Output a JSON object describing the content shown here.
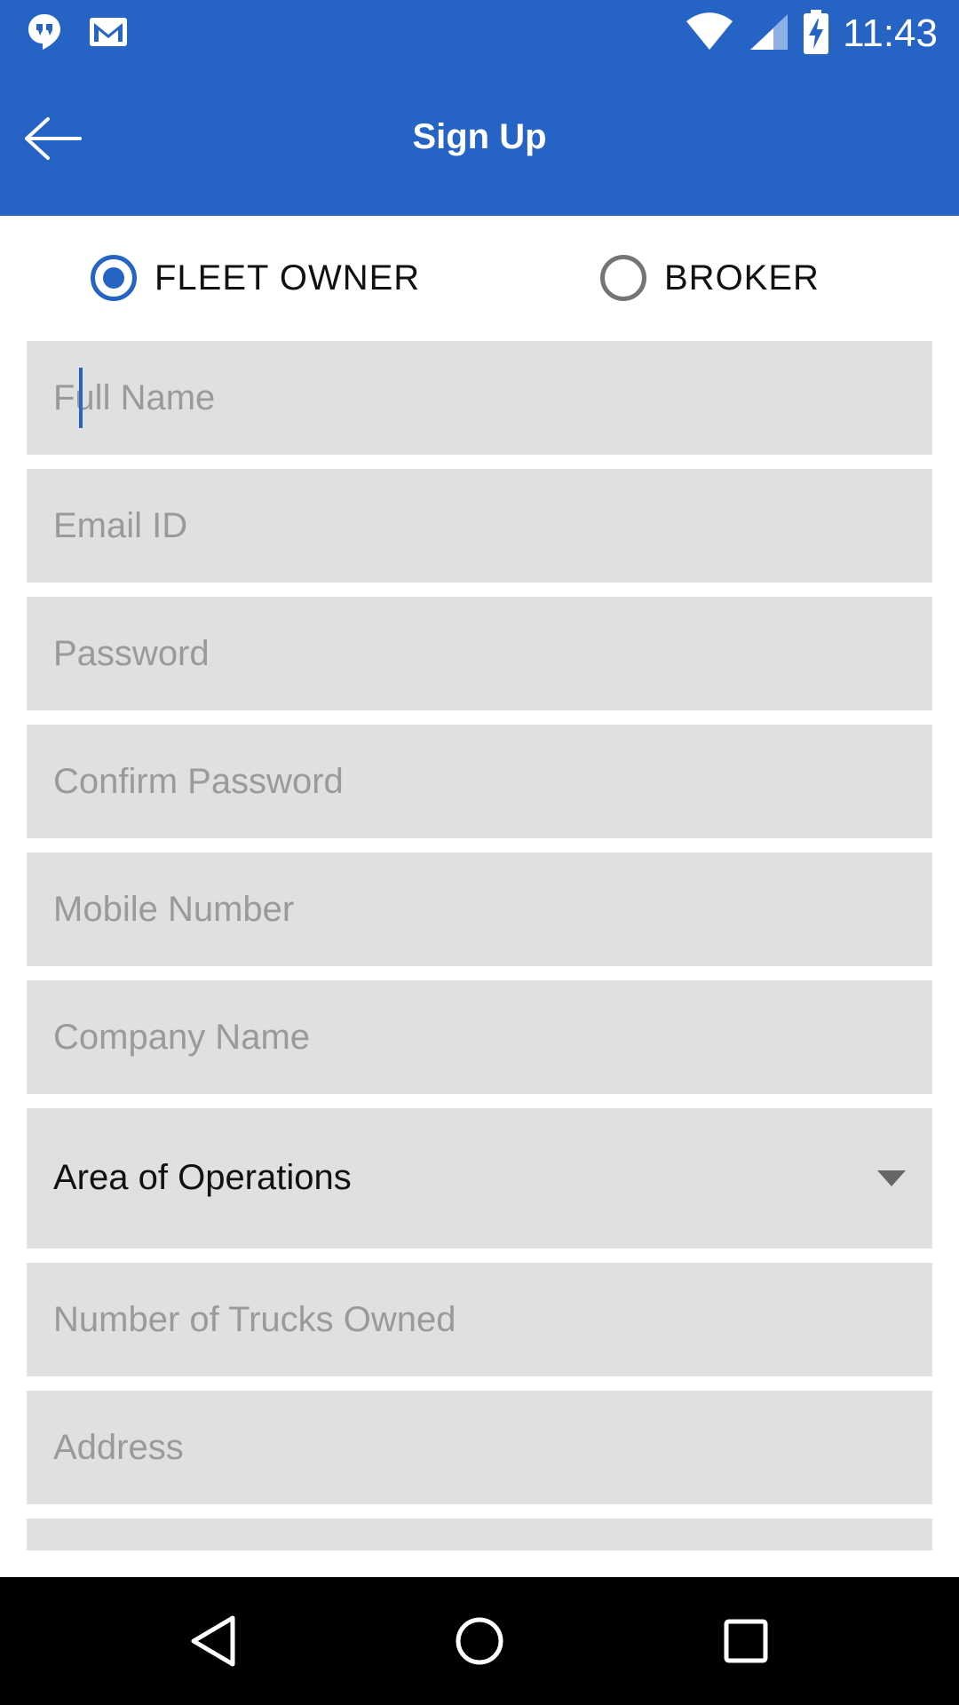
{
  "status_bar": {
    "time": "11:43",
    "left_icons": [
      "hangouts-icon",
      "gmail-icon"
    ],
    "right_icons": [
      "wifi-icon",
      "signal-icon",
      "battery-charging-icon"
    ]
  },
  "app_bar": {
    "title": "Sign Up",
    "back_icon": "back-arrow-icon",
    "color": "#2563C4"
  },
  "role_options": [
    {
      "label": "FLEET OWNER",
      "checked": true
    },
    {
      "label": "BROKER",
      "checked": false
    }
  ],
  "form": {
    "full_name": {
      "placeholder": "Full Name",
      "value": ""
    },
    "email": {
      "placeholder": "Email ID",
      "value": ""
    },
    "password": {
      "placeholder": "Password",
      "value": ""
    },
    "confirm_password": {
      "placeholder": "Confirm Password",
      "value": ""
    },
    "mobile": {
      "placeholder": "Mobile Number",
      "value": ""
    },
    "company": {
      "placeholder": "Company Name",
      "value": ""
    },
    "area_of_operations": {
      "selected": "Area of Operations"
    },
    "trucks_owned": {
      "placeholder": "Number of Trucks Owned",
      "value": ""
    },
    "address": {
      "placeholder": "Address",
      "value": ""
    }
  },
  "nav_bar": {
    "buttons": [
      "back-triangle-icon",
      "home-circle-icon",
      "recents-square-icon"
    ]
  }
}
